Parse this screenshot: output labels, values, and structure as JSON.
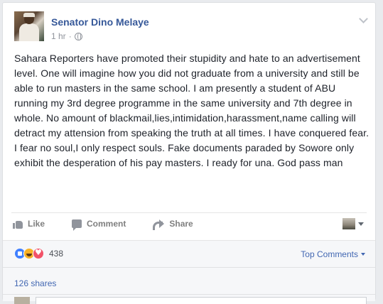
{
  "post": {
    "author": "Senator Dino Melaye",
    "time": "1 hr",
    "privacy_icon": "globe-icon",
    "menu_icon": "chevron-down-icon",
    "text": "Sahara Reporters have promoted their stupidity and hate to an advertisement level. One will imagine how you did not graduate from a university and still be able to run masters in the same school. I am presently a student of ABU running my 3rd degree programme in the same university and 7th degree in whole. No amount of blackmail,lies,intimidation,harassment,name calling will detract my attension from speaking the truth at all times. I have conquered fear. I fear no soul,I only respect souls. Fake documents paraded by Sowore only exhibit the desperation of his pay masters. I ready for una. God pass man"
  },
  "actions": {
    "like_label": "Like",
    "comment_label": "Comment",
    "share_label": "Share"
  },
  "reactions": {
    "types": [
      "like",
      "haha",
      "love"
    ],
    "count": "438",
    "top_comments_label": "Top Comments"
  },
  "shares": {
    "label": "126 shares"
  },
  "colors": {
    "link_blue": "#365899",
    "action_gray": "#7f7f7f",
    "like_blue": "#4080ff",
    "haha_yellow": "#f7b125",
    "love_red": "#f25268"
  }
}
